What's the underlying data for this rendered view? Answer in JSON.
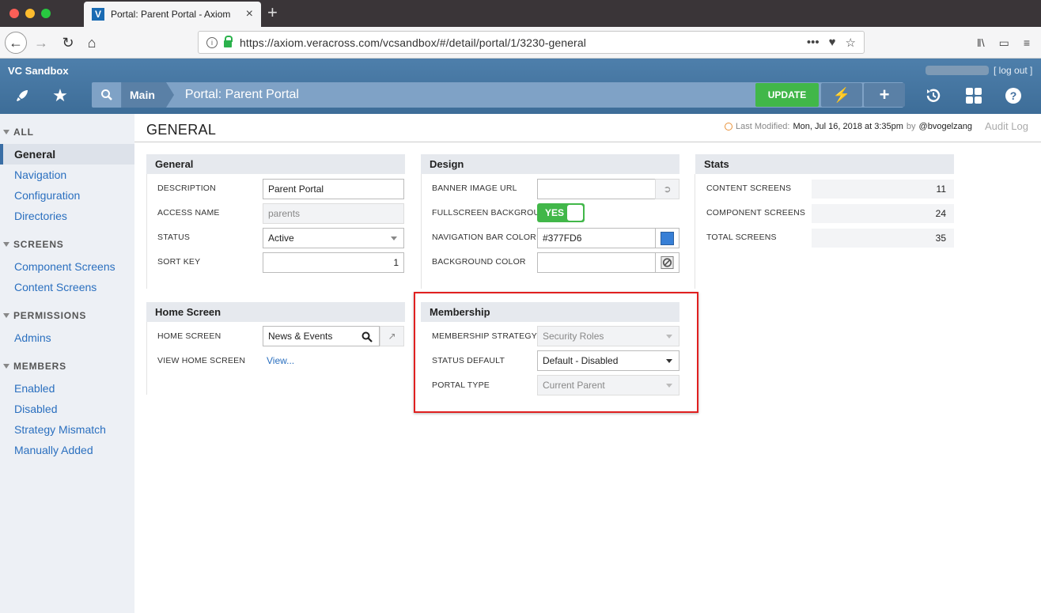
{
  "browser": {
    "tab_title": "Portal: Parent Portal - Axiom",
    "tab_favicon": "V",
    "url": "https://axiom.veracross.com/vcsandbox/#/detail/portal/1/3230-general"
  },
  "header": {
    "org": "VC Sandbox",
    "logout": "[ log out ]",
    "crumb_main": "Main",
    "crumb_title": "Portal: Parent Portal",
    "update_label": "UPDATE",
    "accent": "#41b749"
  },
  "sidebar": {
    "sections": [
      {
        "title": "ALL",
        "items": [
          "General",
          "Navigation",
          "Configuration",
          "Directories"
        ]
      },
      {
        "title": "SCREENS",
        "items": [
          "Component Screens",
          "Content Screens"
        ]
      },
      {
        "title": "PERMISSIONS",
        "items": [
          "Admins"
        ]
      },
      {
        "title": "MEMBERS",
        "items": [
          "Enabled",
          "Disabled",
          "Strategy Mismatch",
          "Manually Added"
        ]
      }
    ]
  },
  "page": {
    "title": "GENERAL",
    "modified_label": "Last Modified:",
    "modified_value": "Mon, Jul 16, 2018 at 3:35pm",
    "modified_by_label": "by",
    "modified_by": "@bvogelzang",
    "audit_log": "Audit Log"
  },
  "general": {
    "title": "General",
    "description_label": "DESCRIPTION",
    "description_value": "Parent Portal",
    "access_label": "ACCESS NAME",
    "access_value": "parents",
    "status_label": "STATUS",
    "status_value": "Active",
    "sort_label": "SORT KEY",
    "sort_value": "1"
  },
  "home": {
    "title": "Home Screen",
    "home_label": "HOME SCREEN",
    "home_value": "News & Events",
    "view_label": "VIEW HOME SCREEN",
    "view_link": "View..."
  },
  "design": {
    "title": "Design",
    "banner_label": "BANNER IMAGE URL",
    "fullscreen_label": "FULLSCREEN BACKGROU...",
    "fullscreen_value": "YES",
    "navcolor_label": "NAVIGATION BAR COLOR",
    "navcolor_value": "#377FD6",
    "bgcolor_label": "BACKGROUND COLOR"
  },
  "membership": {
    "title": "Membership",
    "strategy_label": "MEMBERSHIP STRATEGY",
    "strategy_value": "Security Roles",
    "status_label": "STATUS DEFAULT",
    "status_value": "Default - Disabled",
    "type_label": "PORTAL TYPE",
    "type_value": "Current Parent"
  },
  "stats": {
    "title": "Stats",
    "rows": [
      {
        "label": "CONTENT SCREENS",
        "value": "11"
      },
      {
        "label": "COMPONENT SCREENS",
        "value": "24"
      },
      {
        "label": "TOTAL SCREENS",
        "value": "35"
      }
    ]
  }
}
